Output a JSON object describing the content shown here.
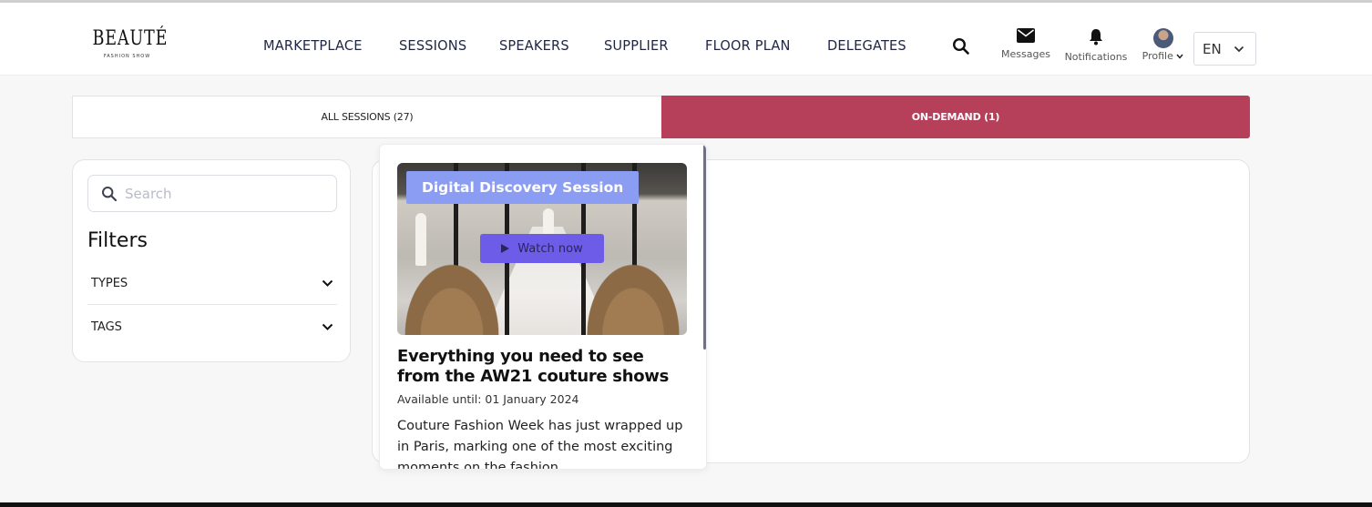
{
  "header": {
    "logo_main": "BEAUTÉ",
    "logo_sub": "FASHION SHOW",
    "nav": [
      "MARKETPLACE",
      "SESSIONS",
      "SPEAKERS",
      "SUPPLIER",
      "FLOOR PLAN",
      "DELEGATES"
    ],
    "messages_label": "Messages",
    "notifications_label": "Notifications",
    "profile_label": "Profile",
    "language": "EN"
  },
  "tabs": {
    "all": "ALL SESSIONS (27)",
    "ondemand": "ON-DEMAND (1)",
    "active_color": "#b6405a"
  },
  "filters": {
    "search_placeholder": "Search",
    "title": "Filters",
    "types_label": "TYPES",
    "tags_label": "TAGS"
  },
  "session": {
    "badge": "Digital Discovery Session",
    "badge_color": "#8b9cf3",
    "watch_label": "Watch now",
    "watch_color": "#6d5ce8",
    "title": "Everything you need to see from the AW21 couture shows",
    "available": "Available until: 01 January 2024",
    "description": "Couture Fashion Week has just wrapped up in Paris, marking one of the most exciting moments on the fashion"
  },
  "icons": {
    "search": "search-icon",
    "messages": "envelope-icon",
    "notifications": "bell-icon",
    "chevron": "chevron-down-icon",
    "play": "play-icon"
  }
}
